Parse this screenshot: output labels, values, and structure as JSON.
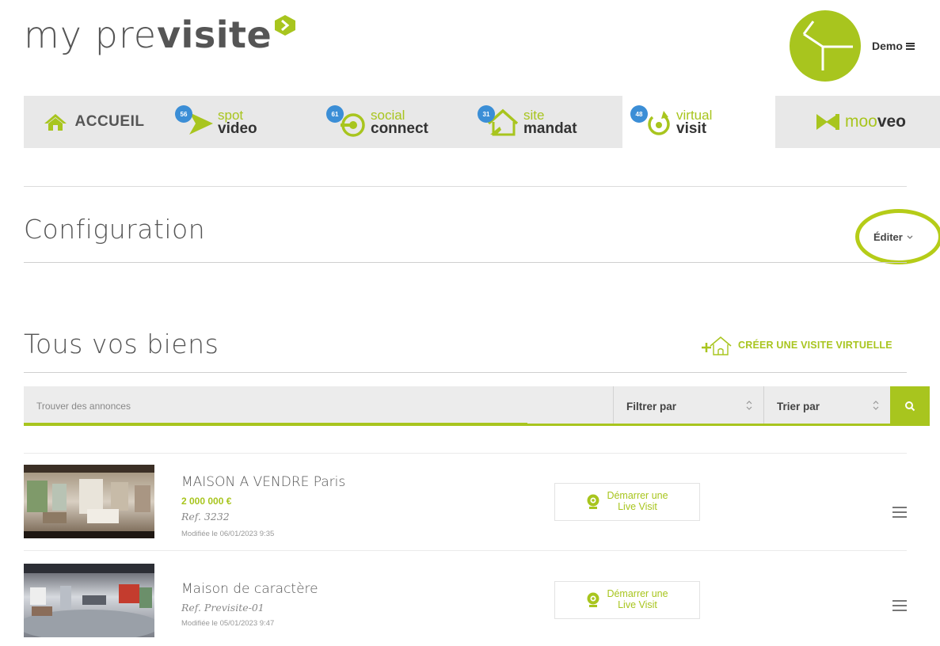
{
  "header": {
    "logo_light": "my pre",
    "logo_bold": "visite",
    "user_name": "Demo"
  },
  "nav": {
    "home": {
      "label": "ACCUEIL",
      "icon": "home-icon"
    },
    "products": [
      {
        "id": "spot-video",
        "light": "spot",
        "bold": "video",
        "badge": "56",
        "icon": "play-arrow-icon"
      },
      {
        "id": "social-connect",
        "light": "social",
        "bold": "connect",
        "badge": "61",
        "icon": "connect-ring-icon"
      },
      {
        "id": "site-mandat",
        "light": "site",
        "bold": "mandat",
        "badge": "31",
        "icon": "house-icon"
      },
      {
        "id": "virtual-visit",
        "light": "virtual",
        "bold": "visit",
        "badge": "48",
        "icon": "rotate-icon",
        "active": true
      }
    ],
    "mooveo": {
      "light": "moo",
      "bold": "veo",
      "icon": "mooveo-icon"
    }
  },
  "config": {
    "title": "Configuration",
    "edit_label": "Éditer"
  },
  "listings_section": {
    "title": "Tous vos biens",
    "create_label": "CRÉER UNE VISITE VIRTUELLE"
  },
  "search": {
    "placeholder": "Trouver des annonces",
    "filter_label": "Filtrer par",
    "sort_label": "Trier par"
  },
  "listings": [
    {
      "title": "MAISON A VENDRE Paris",
      "price": "2 000 000 €",
      "ref": "Ref. 3232",
      "modified": "Modifiée le 06/01/2023 9:35",
      "live_line1": "Démarrer une",
      "live_line2": "Live Visit"
    },
    {
      "title": "Maison de caractère",
      "price": "",
      "ref": "Ref. Previsite-01",
      "modified": "Modifiée le 05/01/2023 9:47",
      "live_line1": "Démarrer une",
      "live_line2": "Live Visit"
    }
  ],
  "colors": {
    "accent": "#a8c51e",
    "badge": "#3b8ed6",
    "nav_bg": "#e8e8e8",
    "text": "#555555"
  }
}
